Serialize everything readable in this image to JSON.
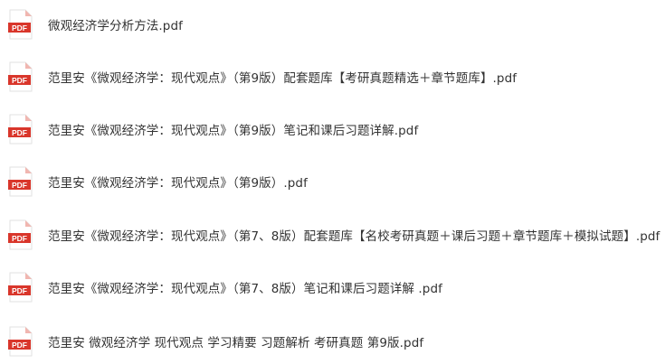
{
  "icon": {
    "name": "pdf-file-icon",
    "label": "PDF",
    "color": "#d9362b",
    "fold_color": "#f1b6b0"
  },
  "files": [
    {
      "name": "微观经济学分析方法.pdf"
    },
    {
      "name": "范里安《微观经济学：现代观点》（第9版）配套题库【考研真题精选＋章节题库】.pdf"
    },
    {
      "name": "范里安《微观经济学：现代观点》（第9版）笔记和课后习题详解.pdf"
    },
    {
      "name": "范里安《微观经济学：现代观点》（第9版）.pdf"
    },
    {
      "name": "范里安《微观经济学：现代观点》（第7、8版）配套题库【名校考研真题＋课后习题＋章节题库＋模拟试题】.pdf"
    },
    {
      "name": "范里安《微观经济学：现代观点》（第7、8版）笔记和课后习题详解 .pdf"
    },
    {
      "name": "范里安 微观经济学 现代观点 学习精要 习题解析 考研真题 第9版.pdf"
    }
  ]
}
